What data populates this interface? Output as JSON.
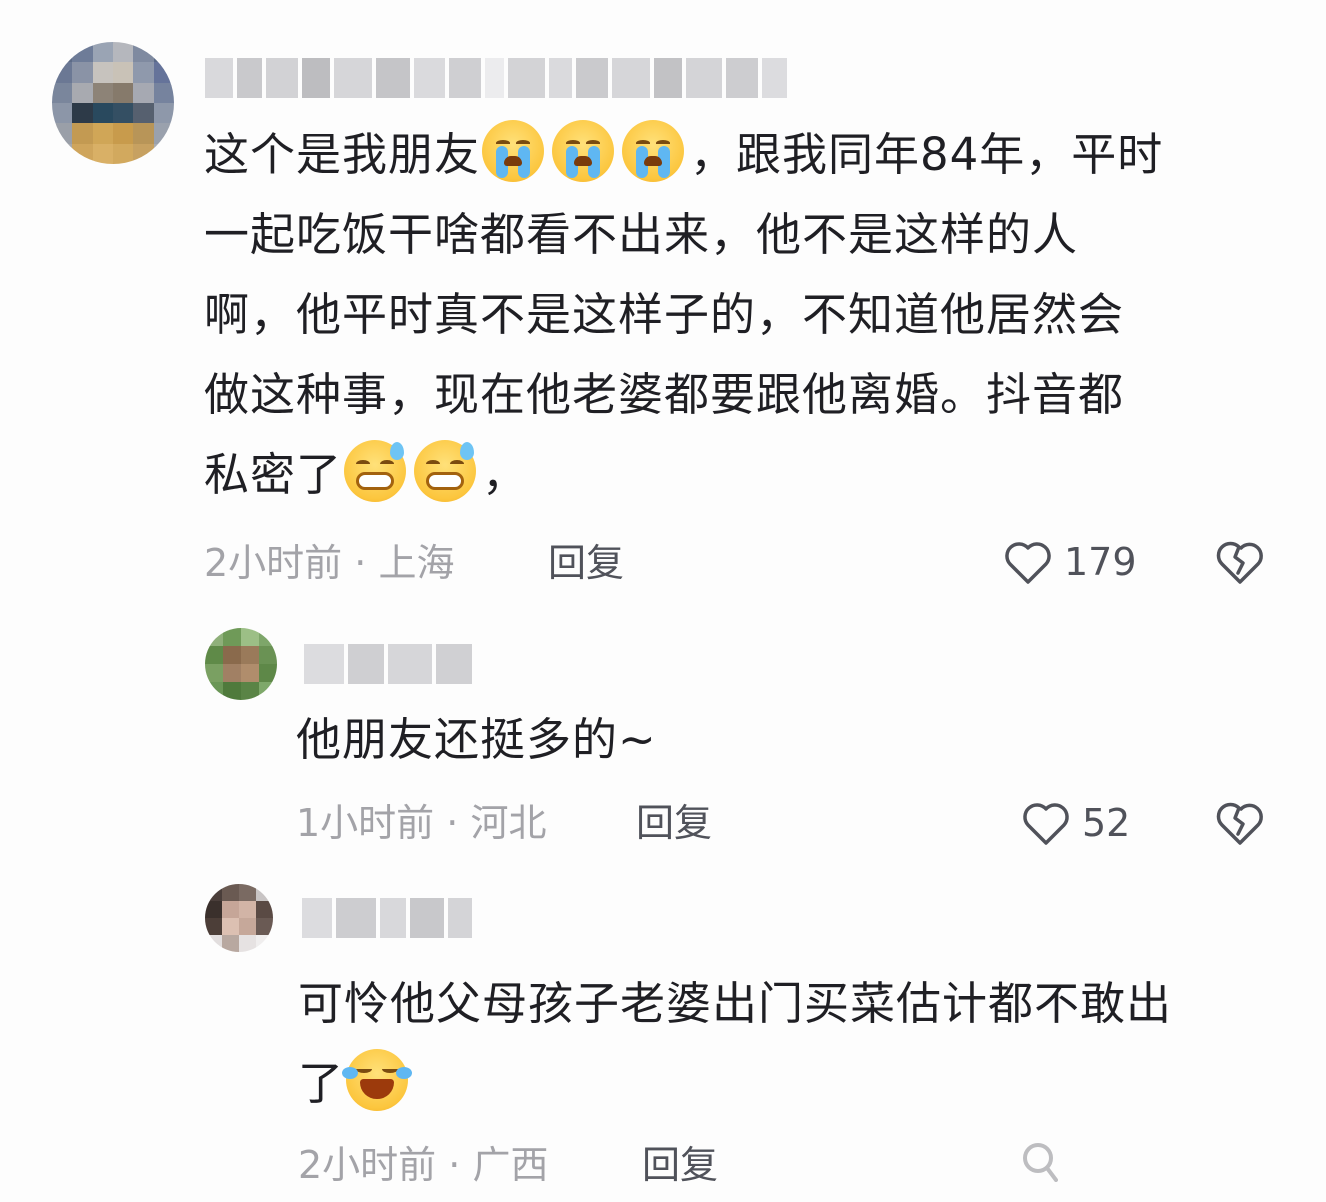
{
  "comments": [
    {
      "text_lines": [
        "这个是我朋友",
        "，跟我同年84年，平时",
        "一起吃饭干啥都看不出来，他不是这样的人",
        "啊，他平时真不是这样子的，不知道他居然会",
        "做这种事，现在他老婆都要跟他离婚。抖音都",
        "私密了",
        "，"
      ],
      "emojis_line1": [
        "cry",
        "cry",
        "cry"
      ],
      "emojis_line5": [
        "sweat",
        "sweat"
      ],
      "time": "2小时前",
      "location": "上海",
      "separator": "·",
      "reply_label": "回复",
      "likes": "179"
    },
    {
      "text": "他朋友还挺多的~",
      "time": "1小时前",
      "location": "河北",
      "separator": "·",
      "reply_label": "回复",
      "likes": "52"
    },
    {
      "text_lines": [
        "可怜他父母孩子老婆出门买菜估计都不敢出",
        "了"
      ],
      "emojis_line1": [
        "laugh"
      ],
      "time": "2小时前",
      "location": "广西",
      "separator": "·",
      "reply_label": "回复"
    }
  ],
  "icons": {
    "like": "heart-outline-icon",
    "dislike": "broken-heart-icon"
  },
  "colors": {
    "text": "#1f1f24",
    "meta": "#a3a3a8",
    "action": "#50525a"
  }
}
